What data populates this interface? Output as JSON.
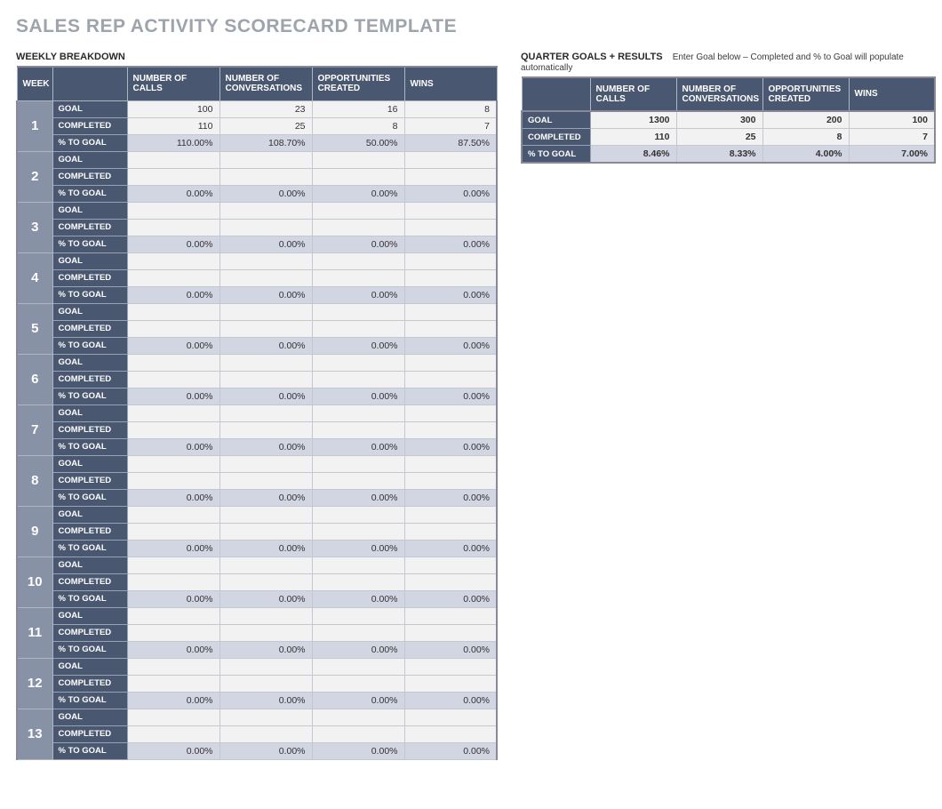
{
  "page_title": "SALES REP ACTIVITY SCORECARD TEMPLATE",
  "weekly": {
    "section_title": "WEEKLY BREAKDOWN",
    "headers": {
      "week": "WEEK",
      "spacer": "",
      "calls": "NUMBER OF CALLS",
      "conv": "NUMBER OF CONVERSATIONS",
      "opp": "OPPORTUNITIES CREATED",
      "wins": "WINS"
    },
    "row_labels": {
      "goal": "GOAL",
      "completed": "COMPLETED",
      "pct": "% TO GOAL"
    },
    "weeks": [
      {
        "num": "1",
        "goal": [
          "100",
          "23",
          "16",
          "8"
        ],
        "completed": [
          "110",
          "25",
          "8",
          "7"
        ],
        "pct": [
          "110.00%",
          "108.70%",
          "50.00%",
          "87.50%"
        ]
      },
      {
        "num": "2",
        "goal": [
          "",
          "",
          "",
          ""
        ],
        "completed": [
          "",
          "",
          "",
          ""
        ],
        "pct": [
          "0.00%",
          "0.00%",
          "0.00%",
          "0.00%"
        ]
      },
      {
        "num": "3",
        "goal": [
          "",
          "",
          "",
          ""
        ],
        "completed": [
          "",
          "",
          "",
          ""
        ],
        "pct": [
          "0.00%",
          "0.00%",
          "0.00%",
          "0.00%"
        ]
      },
      {
        "num": "4",
        "goal": [
          "",
          "",
          "",
          ""
        ],
        "completed": [
          "",
          "",
          "",
          ""
        ],
        "pct": [
          "0.00%",
          "0.00%",
          "0.00%",
          "0.00%"
        ]
      },
      {
        "num": "5",
        "goal": [
          "",
          "",
          "",
          ""
        ],
        "completed": [
          "",
          "",
          "",
          ""
        ],
        "pct": [
          "0.00%",
          "0.00%",
          "0.00%",
          "0.00%"
        ]
      },
      {
        "num": "6",
        "goal": [
          "",
          "",
          "",
          ""
        ],
        "completed": [
          "",
          "",
          "",
          ""
        ],
        "pct": [
          "0.00%",
          "0.00%",
          "0.00%",
          "0.00%"
        ]
      },
      {
        "num": "7",
        "goal": [
          "",
          "",
          "",
          ""
        ],
        "completed": [
          "",
          "",
          "",
          ""
        ],
        "pct": [
          "0.00%",
          "0.00%",
          "0.00%",
          "0.00%"
        ]
      },
      {
        "num": "8",
        "goal": [
          "",
          "",
          "",
          ""
        ],
        "completed": [
          "",
          "",
          "",
          ""
        ],
        "pct": [
          "0.00%",
          "0.00%",
          "0.00%",
          "0.00%"
        ]
      },
      {
        "num": "9",
        "goal": [
          "",
          "",
          "",
          ""
        ],
        "completed": [
          "",
          "",
          "",
          ""
        ],
        "pct": [
          "0.00%",
          "0.00%",
          "0.00%",
          "0.00%"
        ]
      },
      {
        "num": "10",
        "goal": [
          "",
          "",
          "",
          ""
        ],
        "completed": [
          "",
          "",
          "",
          ""
        ],
        "pct": [
          "0.00%",
          "0.00%",
          "0.00%",
          "0.00%"
        ]
      },
      {
        "num": "11",
        "goal": [
          "",
          "",
          "",
          ""
        ],
        "completed": [
          "",
          "",
          "",
          ""
        ],
        "pct": [
          "0.00%",
          "0.00%",
          "0.00%",
          "0.00%"
        ]
      },
      {
        "num": "12",
        "goal": [
          "",
          "",
          "",
          ""
        ],
        "completed": [
          "",
          "",
          "",
          ""
        ],
        "pct": [
          "0.00%",
          "0.00%",
          "0.00%",
          "0.00%"
        ]
      },
      {
        "num": "13",
        "goal": [
          "",
          "",
          "",
          ""
        ],
        "completed": [
          "",
          "",
          "",
          ""
        ],
        "pct": [
          "0.00%",
          "0.00%",
          "0.00%",
          "0.00%"
        ]
      }
    ]
  },
  "quarter": {
    "section_title": "QUARTER GOALS + RESULTS",
    "hint": "Enter Goal below – Completed and % to Goal will populate automatically",
    "headers": {
      "calls": "NUMBER OF CALLS",
      "conv": "NUMBER OF CONVERSATIONS",
      "opp": "OPPORTUNITIES CREATED",
      "wins": "WINS"
    },
    "row_labels": {
      "goal": "GOAL",
      "completed": "COMPLETED",
      "pct": "% TO GOAL"
    },
    "goal": [
      "1300",
      "300",
      "200",
      "100"
    ],
    "completed": [
      "110",
      "25",
      "8",
      "7"
    ],
    "pct": [
      "8.46%",
      "8.33%",
      "4.00%",
      "7.00%"
    ]
  }
}
